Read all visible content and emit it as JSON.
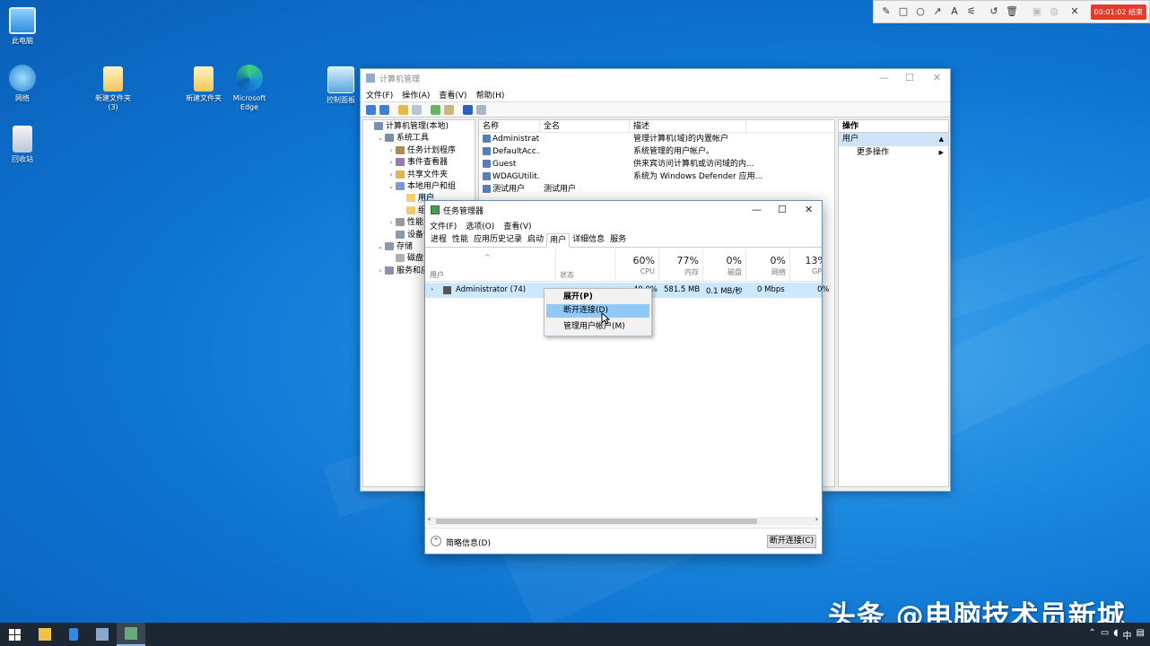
{
  "desktop": {
    "icons": [
      {
        "label": "此电脑"
      },
      {
        "label": "网络"
      },
      {
        "label": "回收站"
      },
      {
        "label": "新建文件夹\n(3)"
      },
      {
        "label": "新建文件夹"
      },
      {
        "label": "Microsoft\nEdge"
      },
      {
        "label": "控制面板"
      }
    ]
  },
  "recorder": {
    "timer": "00:01:02 结束",
    "tools": [
      "pencil-icon",
      "rectangle-icon",
      "circle-icon",
      "arrow-icon",
      "text-icon",
      "highlighter-icon",
      "undo-icon",
      "trash-icon",
      "camera-icon",
      "mic-icon",
      "close-icon"
    ]
  },
  "computer_management": {
    "title": "计算机管理",
    "menu": [
      "文件(F)",
      "操作(A)",
      "查看(V)",
      "帮助(H)"
    ],
    "tree": [
      {
        "label": "计算机管理(本地)",
        "indent": 0,
        "exp": ""
      },
      {
        "label": "系统工具",
        "indent": 1,
        "exp": "v"
      },
      {
        "label": "任务计划程序",
        "indent": 2,
        "exp": ">"
      },
      {
        "label": "事件查看器",
        "indent": 2,
        "exp": ">"
      },
      {
        "label": "共享文件夹",
        "indent": 2,
        "exp": ">"
      },
      {
        "label": "本地用户和组",
        "indent": 2,
        "exp": "v"
      },
      {
        "label": "用户",
        "indent": 3,
        "exp": ""
      },
      {
        "label": "组",
        "indent": 3,
        "exp": ""
      },
      {
        "label": "性能",
        "indent": 2,
        "exp": ">"
      },
      {
        "label": "设备管理器",
        "indent": 2,
        "exp": ""
      },
      {
        "label": "存储",
        "indent": 1,
        "exp": "v"
      },
      {
        "label": "磁盘管理",
        "indent": 2,
        "exp": ""
      },
      {
        "label": "服务和应用程序",
        "indent": 1,
        "exp": ">"
      }
    ],
    "list_headers": [
      "名称",
      "全名",
      "描述"
    ],
    "list_rows": [
      {
        "name": "Administrat...",
        "fullname": "",
        "desc": "管理计算机(域)的内置帐户"
      },
      {
        "name": "DefaultAcc...",
        "fullname": "",
        "desc": "系统管理的用户帐户。"
      },
      {
        "name": "Guest",
        "fullname": "",
        "desc": "供来宾访问计算机或访问域的内..."
      },
      {
        "name": "WDAGUtilit...",
        "fullname": "",
        "desc": "系统为 Windows Defender 应用..."
      },
      {
        "name": "测试用户",
        "fullname": "测试用户",
        "desc": ""
      }
    ],
    "actions_header": "操作",
    "actions_selected": "用户",
    "actions_more": "更多操作"
  },
  "task_manager": {
    "title": "任务管理器",
    "menu": [
      "文件(F)",
      "选项(O)",
      "查看(V)"
    ],
    "tabs": [
      "进程",
      "性能",
      "应用历史记录",
      "启动",
      "用户",
      "详细信息",
      "服务"
    ],
    "active_tab": "用户",
    "col_user": "用户",
    "col_status": "状态",
    "columns": [
      {
        "pct": "60%",
        "label": "CPU"
      },
      {
        "pct": "77%",
        "label": "内存"
      },
      {
        "pct": "0%",
        "label": "磁盘"
      },
      {
        "pct": "0%",
        "label": "网络"
      },
      {
        "pct": "13%",
        "label": "GPU"
      }
    ],
    "row": {
      "user": "Administrator (74)",
      "cpu": "40.0%",
      "memory": "581.5 MB",
      "disk": "0.1 MB/秒",
      "network": "0 Mbps",
      "gpu": "0%"
    },
    "footer_info": "简略信息(D)",
    "disconnect_button": "断开连接(C)"
  },
  "context_menu": {
    "items": [
      "展开(P)",
      "断开连接(D)",
      "管理用户帐户(M)"
    ]
  },
  "taskbar": {
    "tray": "中"
  },
  "watermark": "头条 @电脑技术员新城"
}
